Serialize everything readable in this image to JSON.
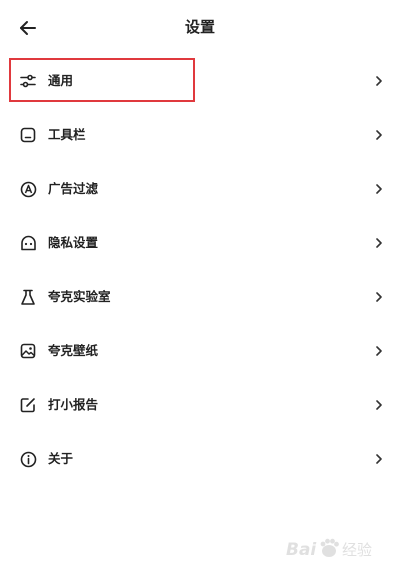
{
  "header": {
    "title": "设置",
    "back_icon": "arrow-left-icon"
  },
  "menu": {
    "items": [
      {
        "label": "通用",
        "icon": "sliders-icon",
        "highlighted": true
      },
      {
        "label": "工具栏",
        "icon": "toolbar-icon"
      },
      {
        "label": "广告过滤",
        "icon": "ad-filter-icon"
      },
      {
        "label": "隐私设置",
        "icon": "privacy-icon"
      },
      {
        "label": "夸克实验室",
        "icon": "flask-icon"
      },
      {
        "label": "夸克壁纸",
        "icon": "wallpaper-icon"
      },
      {
        "label": "打小报告",
        "icon": "report-icon"
      },
      {
        "label": "关于",
        "icon": "info-icon"
      }
    ],
    "chevron_icon": "chevron-right-icon"
  },
  "colors": {
    "highlight": "#e0393e",
    "text": "#222222",
    "background": "#ffffff"
  },
  "watermark": {
    "text": "Baidu经验"
  }
}
